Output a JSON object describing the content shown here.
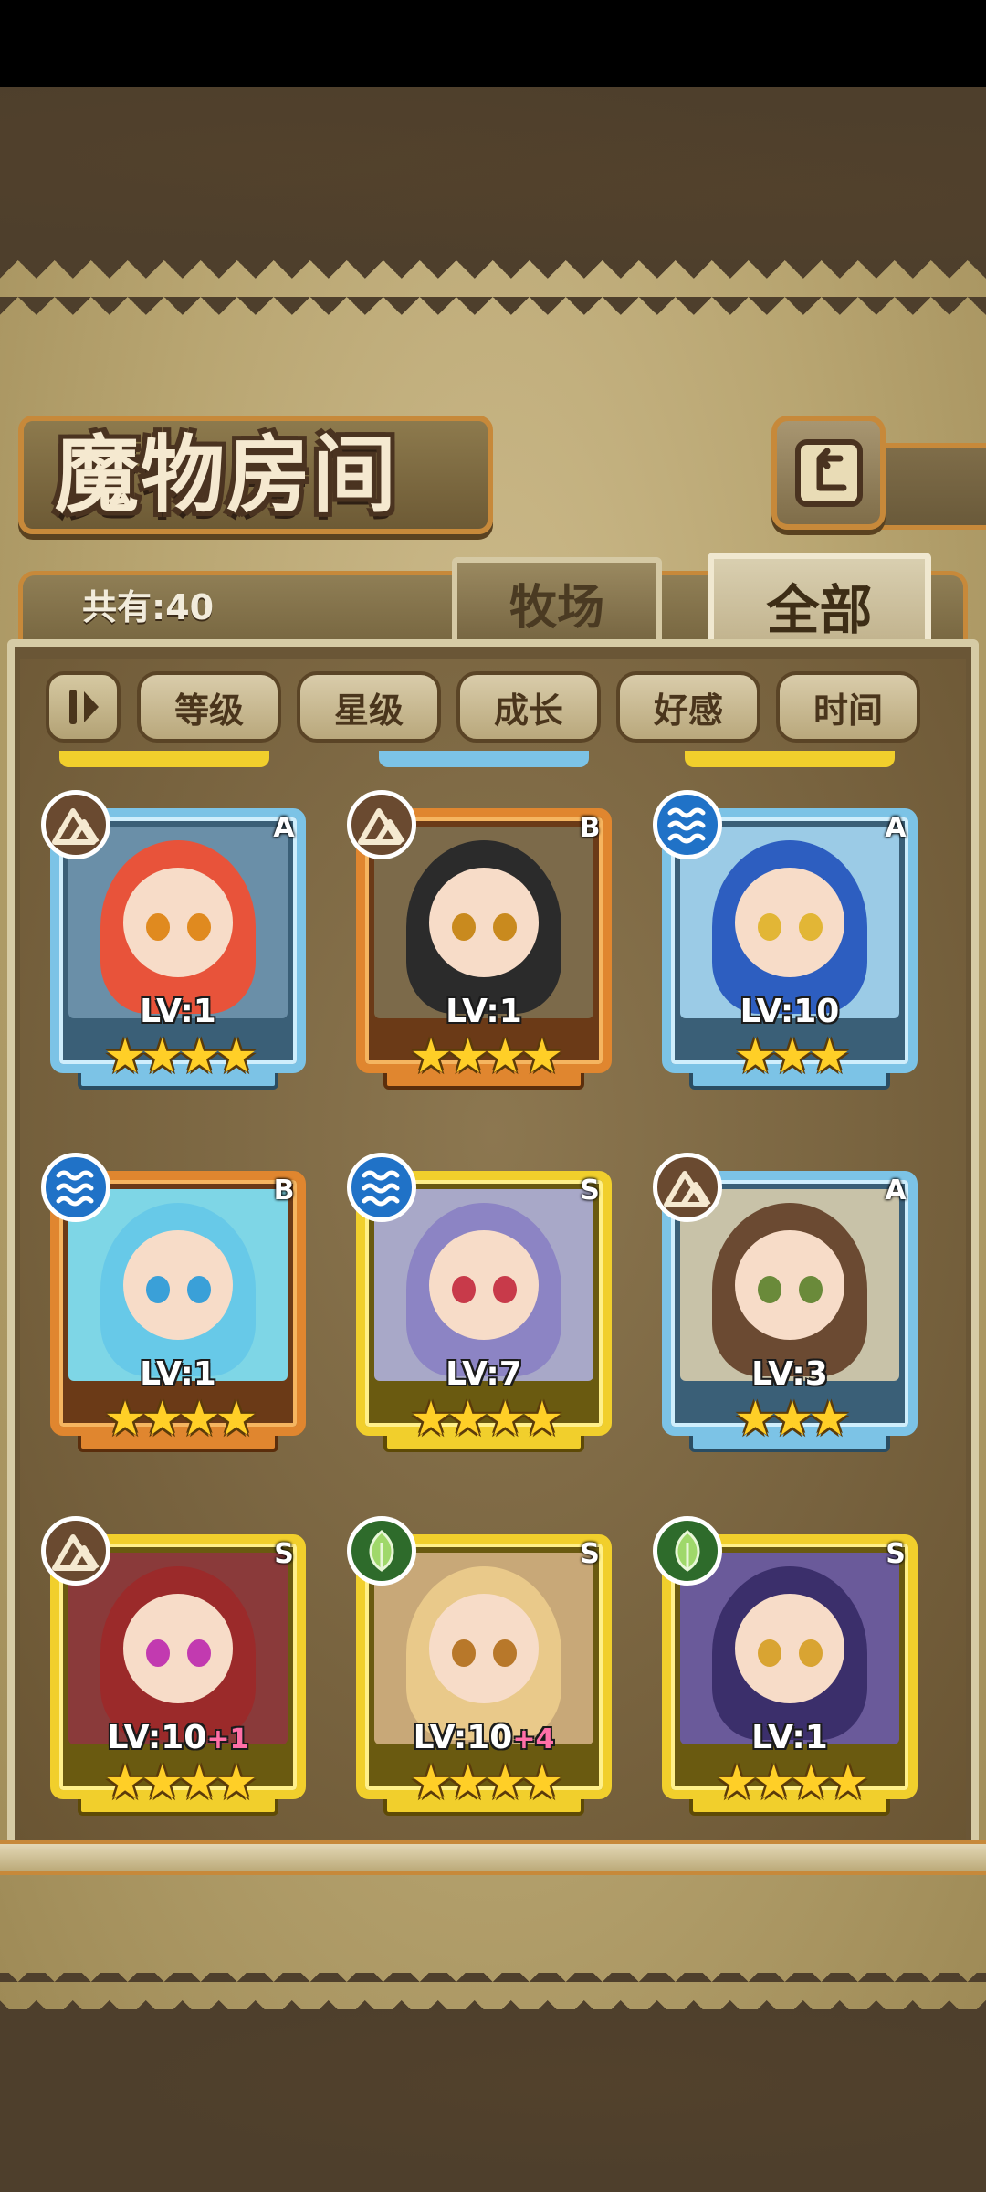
{
  "header": {
    "title": "魔物房间",
    "back_icon": "back-arrow-icon"
  },
  "summary": {
    "count_label": "共有:40"
  },
  "tabs": [
    {
      "label": "牧场",
      "active": false
    },
    {
      "label": "全部",
      "active": true
    }
  ],
  "sort": {
    "toggle_icon": "sort-order-icon",
    "filters": [
      "等级",
      "星级",
      "成长",
      "好感",
      "时间"
    ]
  },
  "colors": {
    "rank_A": "#7cc3e6",
    "rank_B": "#e0862f",
    "rank_S": "#f1cf2c",
    "element_earth": "#6a4a30",
    "element_water": "#2072c7",
    "element_grass": "#2e6b2b",
    "star": "#ffcf27",
    "bonus_level": "#ff6fa8"
  },
  "monsters": [
    {
      "rank": "A",
      "element": "earth",
      "level": "LV:1",
      "bonus": "",
      "stars": 4
    },
    {
      "rank": "B",
      "element": "earth",
      "level": "LV:1",
      "bonus": "",
      "stars": 4
    },
    {
      "rank": "A",
      "element": "water",
      "level": "LV:10",
      "bonus": "",
      "stars": 3
    },
    {
      "rank": "B",
      "element": "water",
      "level": "LV:1",
      "bonus": "",
      "stars": 4
    },
    {
      "rank": "S",
      "element": "water",
      "level": "LV:7",
      "bonus": "",
      "stars": 4
    },
    {
      "rank": "A",
      "element": "earth",
      "level": "LV:3",
      "bonus": "",
      "stars": 3
    },
    {
      "rank": "S",
      "element": "earth",
      "level": "LV:10",
      "bonus": "+1",
      "stars": 4
    },
    {
      "rank": "S",
      "element": "grass",
      "level": "LV:10",
      "bonus": "+4",
      "stars": 4
    },
    {
      "rank": "S",
      "element": "grass",
      "level": "LV:1",
      "bonus": "",
      "stars": 4
    }
  ]
}
